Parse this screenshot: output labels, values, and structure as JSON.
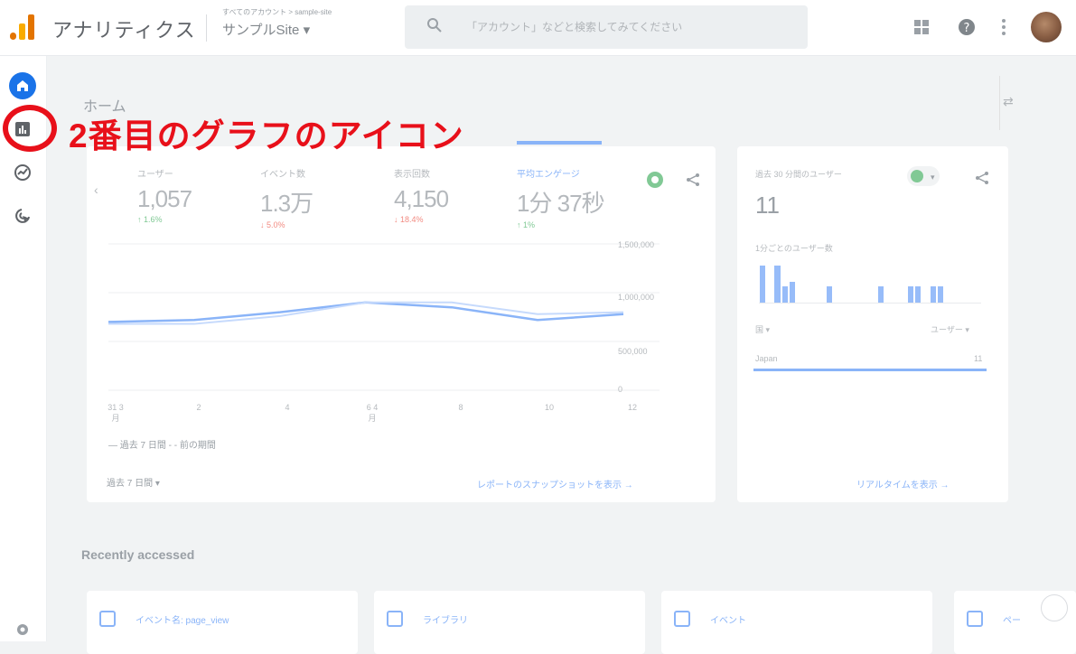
{
  "header": {
    "app_title": "アナリティクス",
    "account_small": "すべてのアカウント > sample-site",
    "account_name": "サンプルSite ▾",
    "search_placeholder": "「アカウント」などと検索してみてください"
  },
  "annotation": "2番目のグラフのアイコン",
  "page": {
    "title": "ホーム",
    "customize": "⇄"
  },
  "overview": {
    "metrics": [
      {
        "label": "ユーザー",
        "value": "1,057",
        "change": "↑ 1.6%",
        "dir": "up"
      },
      {
        "label": "イベント数",
        "value": "1.3万",
        "change": "↓ 5.0%",
        "dir": "down"
      },
      {
        "label": "表示回数",
        "value": "4,150",
        "change": "↓ 18.4%",
        "dir": "down"
      },
      {
        "label": "平均エンゲージ",
        "value": "1分 37秒",
        "change": "↑ 1%",
        "dir": "up"
      }
    ],
    "y_labels": [
      "1,500,000",
      "1,000,000",
      "500,000",
      "0"
    ],
    "x_labels": [
      "31 3月",
      "2",
      "4",
      "6 4月",
      "8",
      "10",
      "12"
    ],
    "legend": "— 過去 7 日間  - - 前の期間",
    "range": "過去 7 日間 ▾",
    "link": "レポートのスナップショットを表示 →"
  },
  "chart_data": {
    "type": "line",
    "categories": [
      "31",
      "2",
      "4",
      "6",
      "8",
      "10",
      "12"
    ],
    "series": [
      {
        "values": [
          700000,
          720000,
          800000,
          900000,
          850000,
          720000,
          780000
        ]
      },
      {
        "values": [
          680000,
          680000,
          760000,
          900000,
          900000,
          780000,
          800000
        ]
      }
    ],
    "xlabel": "",
    "ylabel": "",
    "ylim": [
      0,
      1500000
    ]
  },
  "realtime": {
    "label": "過去 30 分間のユーザー",
    "value": "11",
    "sub": "1分ごとのユーザー数",
    "bars": [
      0.9,
      0.0,
      0.9,
      0.4,
      0.5,
      0.0,
      0.0,
      0.0,
      0.0,
      0.4,
      0.0,
      0.0,
      0.0,
      0.0,
      0.0,
      0.0,
      0.4,
      0.0,
      0.0,
      0.0,
      0.4,
      0.4,
      0.0,
      0.4,
      0.4,
      0.0,
      0.0,
      0.0,
      0.0,
      0.0
    ],
    "dim_label": "国 ▾",
    "dim_right": "ユーザー ▾",
    "country": "Japan",
    "country_value": "11",
    "link": "リアルタイムを表示 →"
  },
  "recent": {
    "title": "Recently accessed",
    "items": [
      {
        "label": "イベント名: page_view"
      },
      {
        "label": "ライブラリ"
      },
      {
        "label": "イベント"
      },
      {
        "label": "ペー"
      }
    ]
  },
  "colors": {
    "accent": "#1a73e8",
    "annotation": "#e8101a"
  }
}
